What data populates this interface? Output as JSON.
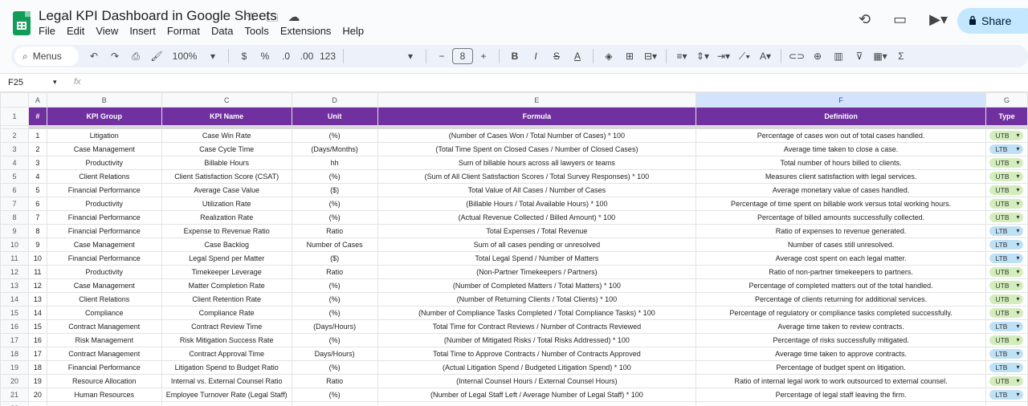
{
  "app": {
    "title": "Legal KPI Dashboard in Google Sheets",
    "menu": [
      "File",
      "Edit",
      "View",
      "Insert",
      "Format",
      "Data",
      "Tools",
      "Extensions",
      "Help"
    ],
    "share_label": "Share"
  },
  "toolbar": {
    "search_label": "Menus",
    "zoom": "100%",
    "currency": "$",
    "percent": "%",
    "dec_decrease": ".0",
    "dec_increase": ".00",
    "number_format": "123",
    "font_size": "8"
  },
  "formula_bar": {
    "cell_ref": "F25",
    "fx": "fx",
    "content": ""
  },
  "columns": [
    "A",
    "B",
    "C",
    "D",
    "E",
    "F",
    "G"
  ],
  "header": [
    "#",
    "KPI Group",
    "KPI Name",
    "Unit",
    "Formula",
    "Definition",
    "Type"
  ],
  "rows": [
    {
      "n": "1",
      "group": "Litigation",
      "name": "Case Win Rate",
      "unit": "(%)",
      "formula": "(Number of Cases Won / Total Number of Cases) * 100",
      "definition": "Percentage of cases won out of total cases handled.",
      "type": "UTB"
    },
    {
      "n": "2",
      "group": "Case Management",
      "name": "Case Cycle Time",
      "unit": "(Days/Months)",
      "formula": "(Total Time Spent on Closed Cases / Number of Closed Cases)",
      "definition": "Average time taken to close a case.",
      "type": "LTB"
    },
    {
      "n": "3",
      "group": "Productivity",
      "name": "Billable Hours",
      "unit": "hh",
      "formula": "Sum of billable hours across all lawyers or teams",
      "definition": "Total number of hours billed to clients.",
      "type": "UTB"
    },
    {
      "n": "4",
      "group": "Client Relations",
      "name": "Client Satisfaction Score (CSAT)",
      "unit": "(%)",
      "formula": "(Sum of All Client Satisfaction Scores / Total Survey Responses) * 100",
      "definition": "Measures client satisfaction with legal services.",
      "type": "UTB"
    },
    {
      "n": "5",
      "group": "Financial Performance",
      "name": "Average Case Value",
      "unit": "($)",
      "formula": "Total Value of All Cases / Number of Cases",
      "definition": "Average monetary value of cases handled.",
      "type": "UTB"
    },
    {
      "n": "6",
      "group": "Productivity",
      "name": "Utilization Rate",
      "unit": "(%)",
      "formula": "(Billable Hours / Total Available Hours) * 100",
      "definition": "Percentage of time spent on billable work versus total working hours.",
      "type": "UTB"
    },
    {
      "n": "7",
      "group": "Financial Performance",
      "name": "Realization Rate",
      "unit": "(%)",
      "formula": "(Actual Revenue Collected / Billed Amount) * 100",
      "definition": "Percentage of billed amounts successfully collected.",
      "type": "UTB"
    },
    {
      "n": "8",
      "group": "Financial Performance",
      "name": "Expense to Revenue Ratio",
      "unit": "Ratio",
      "formula": "Total Expenses / Total Revenue",
      "definition": "Ratio of expenses to revenue generated.",
      "type": "LTB"
    },
    {
      "n": "9",
      "group": "Case Management",
      "name": "Case Backlog",
      "unit": "Number of Cases",
      "formula": "Sum of all cases pending or unresolved",
      "definition": "Number of cases still unresolved.",
      "type": "LTB"
    },
    {
      "n": "10",
      "group": "Financial Performance",
      "name": "Legal Spend per Matter",
      "unit": "($)",
      "formula": "Total Legal Spend / Number of Matters",
      "definition": "Average cost spent on each legal matter.",
      "type": "LTB"
    },
    {
      "n": "11",
      "group": "Productivity",
      "name": "Timekeeper Leverage",
      "unit": "Ratio",
      "formula": "(Non-Partner Timekeepers / Partners)",
      "definition": "Ratio of non-partner timekeepers to partners.",
      "type": "UTB"
    },
    {
      "n": "12",
      "group": "Case Management",
      "name": "Matter Completion Rate",
      "unit": "(%)",
      "formula": "(Number of Completed Matters / Total Matters) * 100",
      "definition": "Percentage of completed matters out of the total handled.",
      "type": "UTB"
    },
    {
      "n": "13",
      "group": "Client Relations",
      "name": "Client Retention Rate",
      "unit": "(%)",
      "formula": "(Number of Returning Clients / Total Clients) * 100",
      "definition": "Percentage of clients returning for additional services.",
      "type": "UTB"
    },
    {
      "n": "14",
      "group": "Compliance",
      "name": "Compliance Rate",
      "unit": "(%)",
      "formula": "(Number of Compliance Tasks Completed / Total Compliance Tasks) * 100",
      "definition": "Percentage of regulatory or compliance tasks completed successfully.",
      "type": "UTB"
    },
    {
      "n": "15",
      "group": "Contract Management",
      "name": "Contract Review Time",
      "unit": "(Days/Hours)",
      "formula": "Total Time for Contract Reviews / Number of Contracts Reviewed",
      "definition": "Average time taken to review contracts.",
      "type": "LTB"
    },
    {
      "n": "16",
      "group": "Risk Management",
      "name": "Risk Mitigation Success Rate",
      "unit": "(%)",
      "formula": "(Number of Mitigated Risks / Total Risks Addressed) * 100",
      "definition": "Percentage of risks successfully mitigated.",
      "type": "UTB"
    },
    {
      "n": "17",
      "group": "Contract Management",
      "name": "Contract Approval Time",
      "unit": "Days/Hours)",
      "formula": "Total Time to Approve Contracts / Number of Contracts Approved",
      "definition": "Average time taken to approve contracts.",
      "type": "LTB"
    },
    {
      "n": "18",
      "group": "Financial Performance",
      "name": "Litigation Spend to Budget Ratio",
      "unit": "(%)",
      "formula": "(Actual Litigation Spend / Budgeted Litigation Spend) * 100",
      "definition": "Percentage of budget spent on litigation.",
      "type": "LTB"
    },
    {
      "n": "19",
      "group": "Resource Allocation",
      "name": "Internal vs. External Counsel Ratio",
      "unit": "Ratio",
      "formula": "(Internal Counsel Hours / External Counsel Hours)",
      "definition": "Ratio of internal legal work to work outsourced to external counsel.",
      "type": "UTB"
    },
    {
      "n": "20",
      "group": "Human Resources",
      "name": "Employee Turnover Rate (Legal Staff)",
      "unit": "(%)",
      "formula": "(Number of Legal Staff Left / Average Number of Legal Staff) * 100",
      "definition": "Percentage of legal staff leaving the firm.",
      "type": "LTB"
    }
  ],
  "colors": {
    "header_bg": "#7030a0",
    "utb_chip": "#d4edbc",
    "ltb_chip": "#bfe1f6",
    "share_bg": "#c2e7ff"
  }
}
